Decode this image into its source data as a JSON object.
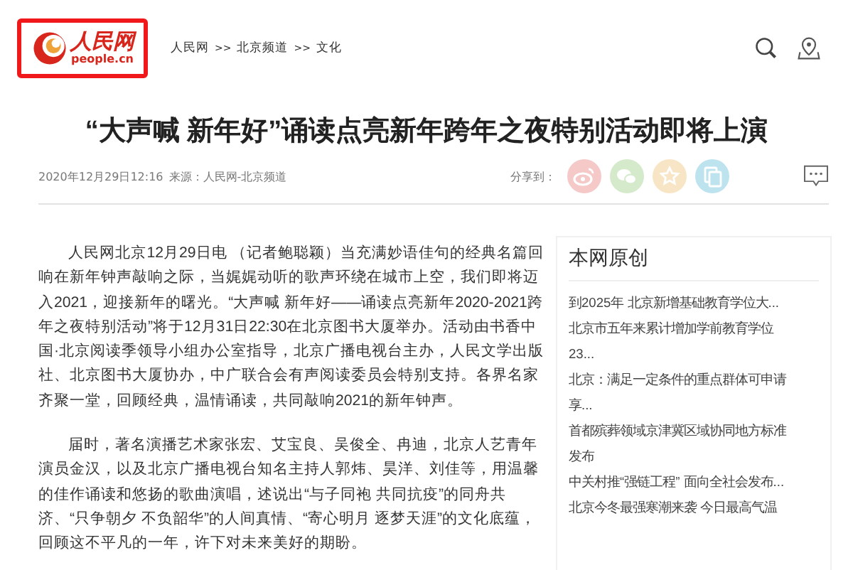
{
  "logo": {
    "name": "人民网",
    "domain": "people.cn"
  },
  "breadcrumb": {
    "separator": ">>",
    "items": [
      "人民网",
      "北京频道",
      "文化"
    ]
  },
  "article": {
    "title": "“大声喊 新年好”诵读点亮新年跨年之夜特别活动即将上演",
    "date": "2020年12月29日12:16",
    "source": "来源：人民网-北京频道",
    "share_label": "分享到：",
    "paragraphs": [
      "人民网北京12月29日电 （记者鲍聪颖）当充满妙语佳句的经典名篇回响在新年钟声敲响之际，当娓娓动听的歌声环绕在城市上空，我们即将迈入2021，迎接新年的曙光。“大声喊 新年好——诵读点亮新年2020-2021跨年之夜特别活动”将于12月31日22:30在北京图书大厦举办。活动由书香中国·北京阅读季领导小组办公室指导，北京广播电视台主办，人民文学出版社、北京图书大厦协办，中广联合会有声阅读委员会特别支持。各界名家齐聚一堂，回顾经典，温情诵读，共同敲响2021的新年钟声。",
      "届时，著名演播艺术家张宏、艾宝良、吴俊全、冉迪，北京人艺青年演员金汉，以及北京广播电视台知名主持人郭炜、昊洋、刘佳等，用温馨的佳作诵读和悠扬的歌曲演唱，述说出“与子同袍 共同抗疫”的同舟共济、“只争朝夕 不负韶华”的人间真情、“寄心明月 逐梦天涯”的文化底蕴，回顾这不平凡的一年，许下对未来美好的期盼。"
    ]
  },
  "sidebar": {
    "title": "本网原创",
    "items": [
      "到2025年 北京新增基础教育学位大...",
      "北京市五年来累计增加学前教育学位23...",
      "北京：满足一定条件的重点群体可申请享...",
      "首都殡葬领域京津冀区域协同地方标准发布",
      "中关村推“强链工程” 面向全社会发布...",
      "北京今冬最强寒潮来袭 今日最高气温"
    ]
  }
}
